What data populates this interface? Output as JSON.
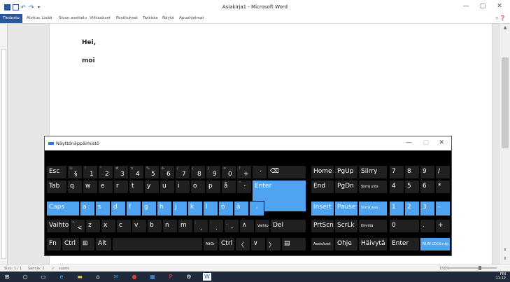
{
  "window": {
    "title": "Asiakirja1 - Microsoft Word",
    "minimize": "—",
    "maximize": "▢",
    "close": "✕"
  },
  "ribbon": {
    "tabs": [
      "Tiedosto",
      "Aloitus",
      "Lisää",
      "Sivun asettelu",
      "Viittaukset",
      "Postitukset",
      "Tarkista",
      "Näytä",
      "Apuohjelmat"
    ],
    "right_icons": "▿ ❓"
  },
  "document": {
    "lines": [
      "Hei,",
      "moi"
    ]
  },
  "statusbar": {
    "page": "Sivu: 1 / 1",
    "words": "Sanoja: 2",
    "language": "suomi",
    "zoom": "150%"
  },
  "taskbar": {
    "lang": "FIN",
    "time": "11:12"
  },
  "osk": {
    "title": "Näyttönäppäimistö",
    "minimize": "—",
    "maximize": "▢",
    "close": "✕",
    "rows": [
      [
        {
          "label": "Esc"
        },
        {
          "label": "§",
          "sup": "½"
        },
        {
          "label": "1",
          "sup": "!"
        },
        {
          "label": "2",
          "sup": "\""
        },
        {
          "label": "3",
          "sup": "#"
        },
        {
          "label": "4",
          "sup": "¤"
        },
        {
          "label": "5",
          "sup": "%"
        },
        {
          "label": "6",
          "sup": "&"
        },
        {
          "label": "7",
          "sup": "/"
        },
        {
          "label": "8",
          "sup": "("
        },
        {
          "label": "9",
          "sup": ")"
        },
        {
          "label": "0",
          "sup": "="
        },
        {
          "label": "+",
          "sup": "?"
        },
        {
          "label": "´",
          "sup": "`"
        },
        {
          "label": "⌫"
        },
        {
          "label": "Home"
        },
        {
          "label": "PgUp"
        },
        {
          "label": "Siirry"
        },
        {
          "label": "7"
        },
        {
          "label": "8"
        },
        {
          "label": "9"
        },
        {
          "label": "/"
        }
      ],
      [
        {
          "label": "Tab"
        },
        {
          "label": "q"
        },
        {
          "label": "w"
        },
        {
          "label": "e"
        },
        {
          "label": "r"
        },
        {
          "label": "t"
        },
        {
          "label": "y"
        },
        {
          "label": "u"
        },
        {
          "label": "i"
        },
        {
          "label": "o"
        },
        {
          "label": "p"
        },
        {
          "label": "å"
        },
        {
          "label": "¨",
          "sup": "^"
        },
        {
          "label": "Enter"
        },
        {
          "label": "End"
        },
        {
          "label": "PgDn"
        },
        {
          "label": "Siirrä ylös"
        },
        {
          "label": "4"
        },
        {
          "label": "5"
        },
        {
          "label": "6"
        },
        {
          "label": "*"
        }
      ],
      [
        {
          "label": "Caps"
        },
        {
          "label": "a"
        },
        {
          "label": "s"
        },
        {
          "label": "d"
        },
        {
          "label": "f"
        },
        {
          "label": "g"
        },
        {
          "label": "h"
        },
        {
          "label": "j"
        },
        {
          "label": "k"
        },
        {
          "label": "l"
        },
        {
          "label": "ö"
        },
        {
          "label": "ä"
        },
        {
          "label": "'",
          "sup": "*"
        },
        {
          "label": "Insert"
        },
        {
          "label": "Pause"
        },
        {
          "label": "Siirrä alas"
        },
        {
          "label": "1"
        },
        {
          "label": "2"
        },
        {
          "label": "3"
        },
        {
          "label": "-"
        }
      ],
      [
        {
          "label": "Vaihto"
        },
        {
          "label": "<",
          "sup": ">"
        },
        {
          "label": "z"
        },
        {
          "label": "x"
        },
        {
          "label": "c"
        },
        {
          "label": "v"
        },
        {
          "label": "b"
        },
        {
          "label": "n"
        },
        {
          "label": "m"
        },
        {
          "label": ",",
          "sup": ";"
        },
        {
          "label": ".",
          "sup": ":"
        },
        {
          "label": "-",
          "sup": "_"
        },
        {
          "label": "∧"
        },
        {
          "label": "Vaihto"
        },
        {
          "label": "Del"
        },
        {
          "label": "PrtScn"
        },
        {
          "label": "ScrLk"
        },
        {
          "label": "Kinnitä"
        },
        {
          "label": "0"
        },
        {
          "label": "."
        },
        {
          "label": "+"
        }
      ],
      [
        {
          "label": "Fn"
        },
        {
          "label": "Ctrl"
        },
        {
          "label": "⊞"
        },
        {
          "label": "Alt"
        },
        {
          "label": ""
        },
        {
          "label": "AltGr"
        },
        {
          "label": "Ctrl"
        },
        {
          "label": "〈"
        },
        {
          "label": "∨"
        },
        {
          "label": "〉"
        },
        {
          "label": "▤"
        },
        {
          "label": "Asetukset"
        },
        {
          "label": "Ohje"
        },
        {
          "label": "Häivytä"
        },
        {
          "label": "Enter"
        },
        {
          "label": "NUM LOCK-näp."
        }
      ]
    ]
  }
}
